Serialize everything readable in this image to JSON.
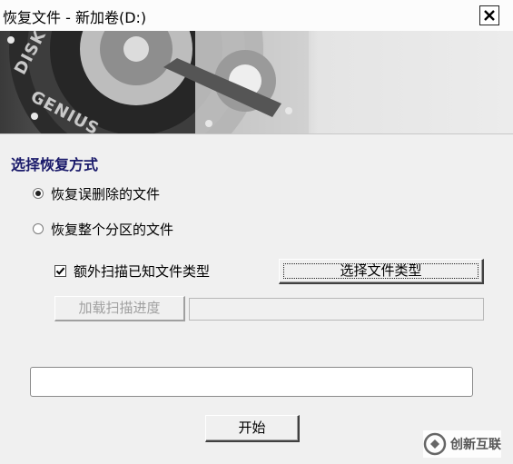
{
  "window": {
    "title": "恢复文件 - 新加卷(D:)"
  },
  "banner": {
    "logo_text_line1": "DISK",
    "logo_text_line2": "GENIUS"
  },
  "section": {
    "title": "选择恢复方式"
  },
  "options": {
    "deleted_label": "恢复误删除的文件",
    "deleted_selected": true,
    "partition_label": "恢复整个分区的文件",
    "partition_selected": false
  },
  "scan_extra": {
    "label": "额外扫描已知文件类型",
    "checked": true
  },
  "buttons": {
    "select_file_type": "选择文件类型",
    "load_progress": "加载扫描进度",
    "start": "开始"
  },
  "progress": {
    "value": 0
  },
  "watermark": {
    "text": "创新互联"
  }
}
